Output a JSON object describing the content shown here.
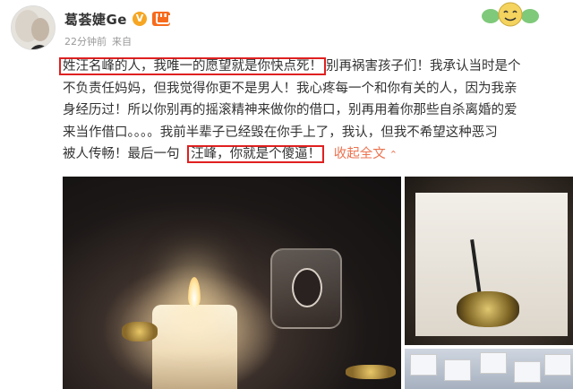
{
  "user": {
    "name": "葛荟婕Ge",
    "verified_badge": "V",
    "timestamp": "22分钟前",
    "source": "来自"
  },
  "post": {
    "lines": [
      {
        "highlight": "姓汪名峰的人，我唯一的愿望就是你快点死！",
        "rest": "别再祸害孩子们！我承认当时是个"
      },
      {
        "text": "不负责任妈妈，但我觉得你更不是男人！我心疼每一个和你有关的人，因为我亲"
      },
      {
        "text": "身经历过！所以你别再的摇滚精神来做你的借口，别再用着你那些自杀离婚的爱"
      },
      {
        "text": "来当作借口。。。。我前半辈子已经毁在你手上了，我认，但我不希望这种恶习"
      },
      {
        "prefix": "被人传畅！最后一句",
        "highlight": "汪峰，你就是个傻逼！",
        "expand": "收起全文"
      }
    ]
  },
  "icons": {
    "vip": "vip-crown-icon",
    "sticker": "smiley-sticker-icon",
    "expand_chevron": "chevron-up-icon"
  },
  "colors": {
    "highlight_border": "#e02020",
    "link": "#eb7350",
    "verified": "#f6a623"
  }
}
